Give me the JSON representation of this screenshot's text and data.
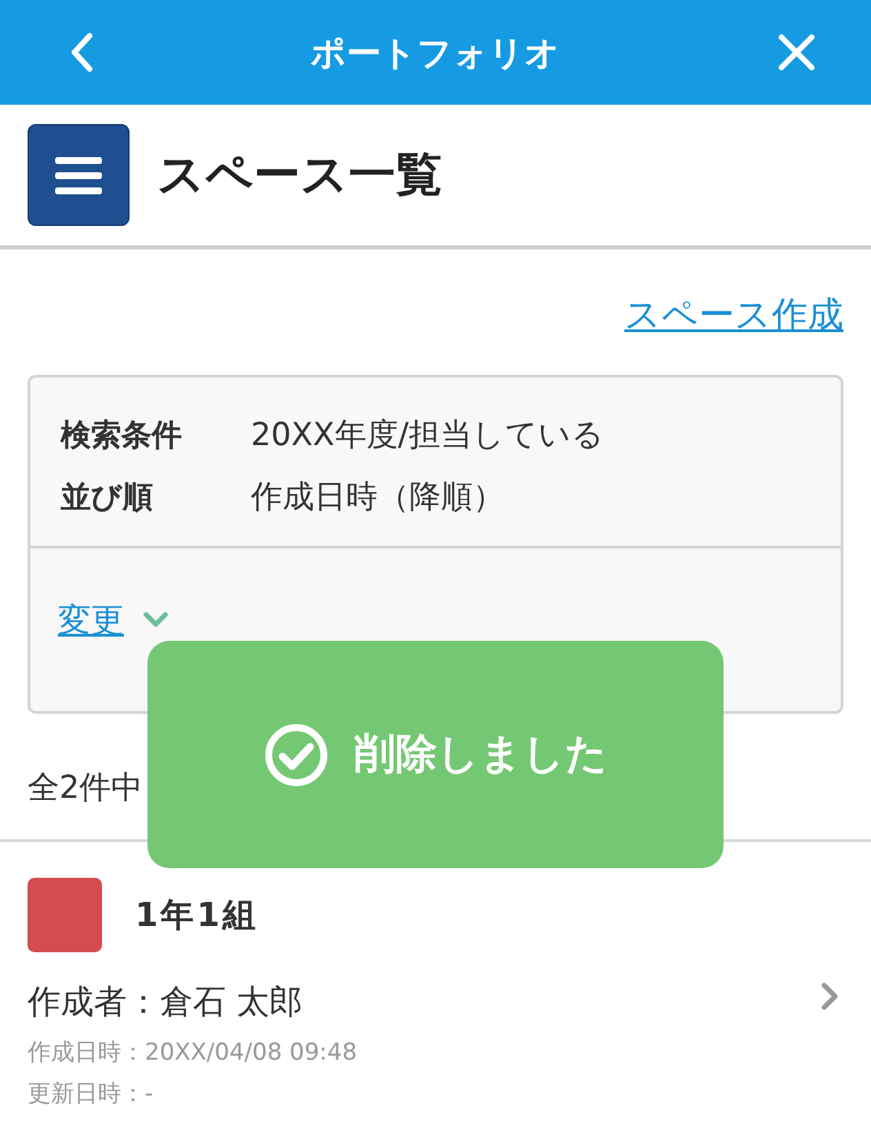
{
  "header": {
    "title": "ポートフォリオ"
  },
  "page": {
    "title": "スペース一覧"
  },
  "create_link": "スペース作成",
  "filter": {
    "conditions": [
      {
        "label": "検索条件",
        "value": "20XX年度/担当している"
      },
      {
        "label": "並び順",
        "value": "作成日時（降順）"
      }
    ],
    "change_link": "変更",
    "expanded": false
  },
  "count": "全2件中",
  "spaces": [
    {
      "name": "1年1組",
      "color": "#d44c4f",
      "creator": "作成者：倉石 太郎",
      "created": "作成日時：20XX/04/08 09:48",
      "updated": "更新日時：-"
    }
  ],
  "toast": {
    "message": "削除しました"
  }
}
